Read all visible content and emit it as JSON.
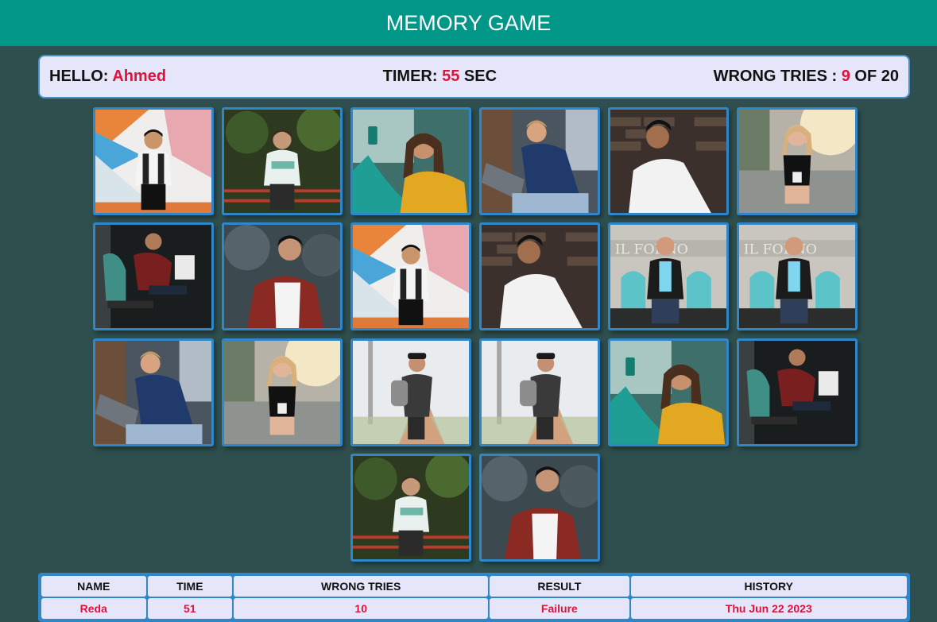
{
  "header": {
    "title": "MEMORY GAME"
  },
  "info": {
    "hello_label": "HELLO:",
    "player_name": "Ahmed",
    "timer_label": "TIMER:",
    "timer_value": "55",
    "timer_unit": "SEC",
    "wrong_label": "WRONG TRIES :",
    "wrong_value": "9",
    "wrong_of": "OF 20"
  },
  "cards": [
    {
      "photo": "man-wall-colorful"
    },
    {
      "photo": "man-sweater-railing"
    },
    {
      "photo": "woman-selfie-yellow"
    },
    {
      "photo": "man-laptop-blue"
    },
    {
      "photo": "man-white-shirt-brick"
    },
    {
      "photo": "woman-street-phone"
    },
    {
      "photo": "man-chair-newspaper"
    },
    {
      "photo": "man-red-jacket"
    },
    {
      "photo": "man-wall-colorful"
    },
    {
      "photo": "man-white-shirt-brick"
    },
    {
      "photo": "man-building-sign"
    },
    {
      "photo": "man-building-sign"
    },
    {
      "photo": "man-laptop-blue"
    },
    {
      "photo": "woman-street-phone"
    },
    {
      "photo": "man-backpack-path"
    },
    {
      "photo": "man-backpack-path"
    },
    {
      "photo": "woman-selfie-yellow"
    },
    {
      "photo": "man-chair-newspaper"
    },
    {
      "photo": "man-sweater-railing"
    },
    {
      "photo": "man-red-jacket"
    }
  ],
  "results": {
    "headers": [
      "NAME",
      "TIME",
      "WRONG TRIES",
      "RESULT",
      "HISTORY"
    ],
    "rows": [
      [
        "Reda",
        "51",
        "10",
        "Failure",
        "Thu Jun 22 2023"
      ]
    ]
  },
  "colors": {
    "header": "#009688",
    "background": "#2f4f4f",
    "panel": "#e6e6fa",
    "accent": "#dc143c",
    "card_border": "#2f86c9"
  }
}
